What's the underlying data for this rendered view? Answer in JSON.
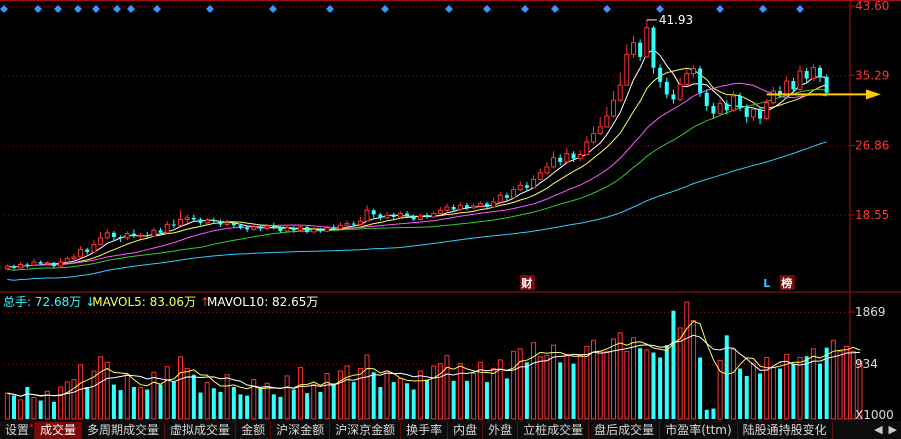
{
  "stock_name": "■■■■",
  "chart_data": [
    {
      "type": "candlestick",
      "title": "",
      "y_ticks": [
        "43.60",
        "35.29",
        "26.86",
        "18.55"
      ],
      "ylim": [
        10.5,
        43.6
      ],
      "max_annotation": "41.93",
      "ma_colors": {
        "ma1": "#ffffff",
        "ma2": "#ffff55",
        "ma3": "#ff55ff",
        "ma4": "#33cc33",
        "ma5": "#33ccff"
      },
      "up_color": "#ff3333",
      "down_color": "#33ffff",
      "markers": [
        {
          "label": "财",
          "index": 78
        },
        {
          "label": "L",
          "index": 114
        },
        {
          "label": "榜",
          "index": 117
        }
      ],
      "arrow_target_price": 33.0,
      "candles": [
        {
          "o": 12.1,
          "c": 12.4,
          "h": 12.6,
          "l": 11.9
        },
        {
          "o": 12.4,
          "c": 12.2,
          "h": 12.6,
          "l": 12.0
        },
        {
          "o": 12.2,
          "c": 12.6,
          "h": 12.9,
          "l": 12.1
        },
        {
          "o": 12.6,
          "c": 12.5,
          "h": 12.8,
          "l": 12.2
        },
        {
          "o": 12.5,
          "c": 12.9,
          "h": 13.3,
          "l": 12.4
        },
        {
          "o": 12.9,
          "c": 12.7,
          "h": 13.1,
          "l": 12.5
        },
        {
          "o": 12.7,
          "c": 12.8,
          "h": 13.0,
          "l": 12.5
        },
        {
          "o": 12.8,
          "c": 12.4,
          "h": 12.9,
          "l": 12.2
        },
        {
          "o": 12.4,
          "c": 12.9,
          "h": 13.4,
          "l": 12.3
        },
        {
          "o": 12.9,
          "c": 13.3,
          "h": 13.6,
          "l": 12.8
        },
        {
          "o": 13.3,
          "c": 13.5,
          "h": 13.9,
          "l": 13.1
        },
        {
          "o": 13.5,
          "c": 14.4,
          "h": 14.8,
          "l": 13.4
        },
        {
          "o": 14.4,
          "c": 14.1,
          "h": 14.6,
          "l": 13.8
        },
        {
          "o": 14.1,
          "c": 15.0,
          "h": 15.5,
          "l": 14.0
        },
        {
          "o": 15.0,
          "c": 15.8,
          "h": 16.5,
          "l": 14.9
        },
        {
          "o": 15.8,
          "c": 16.4,
          "h": 16.8,
          "l": 15.6
        },
        {
          "o": 16.4,
          "c": 15.9,
          "h": 16.6,
          "l": 15.5
        },
        {
          "o": 15.9,
          "c": 15.8,
          "h": 16.1,
          "l": 15.3
        },
        {
          "o": 15.8,
          "c": 16.3,
          "h": 16.6,
          "l": 15.5
        },
        {
          "o": 16.3,
          "c": 16.0,
          "h": 16.8,
          "l": 15.8
        },
        {
          "o": 16.0,
          "c": 16.1,
          "h": 16.4,
          "l": 15.7
        },
        {
          "o": 16.1,
          "c": 16.0,
          "h": 16.5,
          "l": 15.8
        },
        {
          "o": 16.0,
          "c": 16.7,
          "h": 17.0,
          "l": 15.9
        },
        {
          "o": 16.7,
          "c": 16.4,
          "h": 17.0,
          "l": 16.1
        },
        {
          "o": 16.4,
          "c": 17.4,
          "h": 17.8,
          "l": 16.3
        },
        {
          "o": 17.4,
          "c": 17.3,
          "h": 18.0,
          "l": 17.0
        },
        {
          "o": 17.3,
          "c": 18.0,
          "h": 19.1,
          "l": 17.2
        },
        {
          "o": 18.0,
          "c": 18.2,
          "h": 18.6,
          "l": 17.6
        },
        {
          "o": 18.2,
          "c": 18.0,
          "h": 18.6,
          "l": 17.7
        },
        {
          "o": 18.0,
          "c": 17.6,
          "h": 18.2,
          "l": 17.3
        },
        {
          "o": 17.6,
          "c": 17.9,
          "h": 18.2,
          "l": 17.4
        },
        {
          "o": 17.9,
          "c": 17.8,
          "h": 18.2,
          "l": 17.5
        },
        {
          "o": 17.8,
          "c": 17.4,
          "h": 18.0,
          "l": 17.1
        },
        {
          "o": 17.4,
          "c": 17.6,
          "h": 18.0,
          "l": 17.2
        },
        {
          "o": 17.6,
          "c": 17.3,
          "h": 17.8,
          "l": 17.0
        },
        {
          "o": 17.3,
          "c": 17.0,
          "h": 17.5,
          "l": 16.8
        },
        {
          "o": 17.0,
          "c": 16.8,
          "h": 17.3,
          "l": 16.5
        },
        {
          "o": 16.8,
          "c": 17.1,
          "h": 17.4,
          "l": 16.6
        },
        {
          "o": 17.1,
          "c": 16.9,
          "h": 17.4,
          "l": 16.6
        },
        {
          "o": 16.9,
          "c": 17.2,
          "h": 17.5,
          "l": 16.7
        },
        {
          "o": 17.2,
          "c": 17.0,
          "h": 17.6,
          "l": 16.8
        },
        {
          "o": 17.0,
          "c": 16.6,
          "h": 17.2,
          "l": 16.4
        },
        {
          "o": 16.6,
          "c": 17.0,
          "h": 17.4,
          "l": 16.5
        },
        {
          "o": 17.0,
          "c": 16.7,
          "h": 17.2,
          "l": 16.4
        },
        {
          "o": 16.7,
          "c": 17.1,
          "h": 17.4,
          "l": 16.6
        },
        {
          "o": 17.1,
          "c": 16.5,
          "h": 17.2,
          "l": 16.3
        },
        {
          "o": 16.5,
          "c": 16.8,
          "h": 17.1,
          "l": 16.4
        },
        {
          "o": 16.8,
          "c": 16.6,
          "h": 17.0,
          "l": 16.4
        },
        {
          "o": 16.6,
          "c": 17.0,
          "h": 17.3,
          "l": 16.5
        },
        {
          "o": 17.0,
          "c": 16.9,
          "h": 17.4,
          "l": 16.7
        },
        {
          "o": 16.9,
          "c": 17.3,
          "h": 17.7,
          "l": 16.8
        },
        {
          "o": 17.3,
          "c": 17.5,
          "h": 17.9,
          "l": 17.1
        },
        {
          "o": 17.5,
          "c": 17.4,
          "h": 17.8,
          "l": 17.1
        },
        {
          "o": 17.4,
          "c": 17.8,
          "h": 18.3,
          "l": 17.3
        },
        {
          "o": 17.8,
          "c": 19.1,
          "h": 19.7,
          "l": 17.7
        },
        {
          "o": 19.1,
          "c": 18.6,
          "h": 19.3,
          "l": 18.2
        },
        {
          "o": 18.6,
          "c": 18.2,
          "h": 18.8,
          "l": 17.9
        },
        {
          "o": 18.2,
          "c": 18.5,
          "h": 18.9,
          "l": 18.0
        },
        {
          "o": 18.5,
          "c": 18.3,
          "h": 18.8,
          "l": 18.0
        },
        {
          "o": 18.3,
          "c": 18.7,
          "h": 19.0,
          "l": 18.1
        },
        {
          "o": 18.7,
          "c": 18.4,
          "h": 19.0,
          "l": 18.2
        },
        {
          "o": 18.4,
          "c": 18.0,
          "h": 18.6,
          "l": 17.8
        },
        {
          "o": 18.0,
          "c": 18.4,
          "h": 18.7,
          "l": 17.9
        },
        {
          "o": 18.4,
          "c": 18.3,
          "h": 18.8,
          "l": 18.1
        },
        {
          "o": 18.3,
          "c": 18.7,
          "h": 19.0,
          "l": 18.2
        },
        {
          "o": 18.7,
          "c": 19.1,
          "h": 19.5,
          "l": 18.5
        },
        {
          "o": 19.1,
          "c": 19.5,
          "h": 19.9,
          "l": 18.9
        },
        {
          "o": 19.5,
          "c": 19.2,
          "h": 19.8,
          "l": 18.9
        },
        {
          "o": 19.2,
          "c": 19.7,
          "h": 20.1,
          "l": 19.0
        },
        {
          "o": 19.7,
          "c": 19.4,
          "h": 20.0,
          "l": 19.1
        },
        {
          "o": 19.4,
          "c": 19.6,
          "h": 19.9,
          "l": 19.2
        },
        {
          "o": 19.6,
          "c": 19.9,
          "h": 20.2,
          "l": 19.4
        },
        {
          "o": 19.9,
          "c": 19.5,
          "h": 20.1,
          "l": 19.2
        },
        {
          "o": 19.5,
          "c": 20.1,
          "h": 20.6,
          "l": 19.4
        },
        {
          "o": 20.1,
          "c": 20.9,
          "h": 21.3,
          "l": 20.0
        },
        {
          "o": 20.9,
          "c": 20.6,
          "h": 21.2,
          "l": 20.3
        },
        {
          "o": 20.6,
          "c": 21.6,
          "h": 22.0,
          "l": 20.5
        },
        {
          "o": 21.6,
          "c": 22.1,
          "h": 22.6,
          "l": 21.4
        },
        {
          "o": 22.1,
          "c": 21.8,
          "h": 22.5,
          "l": 21.4
        },
        {
          "o": 21.8,
          "c": 22.8,
          "h": 23.3,
          "l": 21.7
        },
        {
          "o": 22.8,
          "c": 23.6,
          "h": 24.1,
          "l": 22.7
        },
        {
          "o": 23.6,
          "c": 24.3,
          "h": 24.9,
          "l": 23.4
        },
        {
          "o": 24.3,
          "c": 25.4,
          "h": 26.2,
          "l": 24.1
        },
        {
          "o": 25.4,
          "c": 24.9,
          "h": 25.8,
          "l": 24.5
        },
        {
          "o": 24.9,
          "c": 25.9,
          "h": 26.6,
          "l": 24.8
        },
        {
          "o": 25.9,
          "c": 25.3,
          "h": 26.2,
          "l": 24.9
        },
        {
          "o": 25.3,
          "c": 25.8,
          "h": 26.3,
          "l": 25.0
        },
        {
          "o": 25.8,
          "c": 27.3,
          "h": 28.0,
          "l": 25.7
        },
        {
          "o": 27.3,
          "c": 28.3,
          "h": 29.2,
          "l": 27.0
        },
        {
          "o": 28.3,
          "c": 29.1,
          "h": 30.3,
          "l": 28.1
        },
        {
          "o": 29.1,
          "c": 30.4,
          "h": 31.5,
          "l": 29.0
        },
        {
          "o": 30.4,
          "c": 32.3,
          "h": 33.4,
          "l": 30.2
        },
        {
          "o": 32.3,
          "c": 34.1,
          "h": 35.6,
          "l": 32.1
        },
        {
          "o": 34.1,
          "c": 37.8,
          "h": 39.0,
          "l": 34.0
        },
        {
          "o": 37.8,
          "c": 39.2,
          "h": 40.0,
          "l": 37.4
        },
        {
          "o": 39.2,
          "c": 37.5,
          "h": 39.6,
          "l": 37.0
        },
        {
          "o": 37.5,
          "c": 41.0,
          "h": 41.93,
          "l": 37.4
        },
        {
          "o": 41.0,
          "c": 36.2,
          "h": 41.2,
          "l": 35.5
        },
        {
          "o": 36.2,
          "c": 34.5,
          "h": 36.6,
          "l": 33.8
        },
        {
          "o": 34.5,
          "c": 33.0,
          "h": 35.0,
          "l": 32.5
        },
        {
          "o": 33.0,
          "c": 32.4,
          "h": 33.6,
          "l": 31.9
        },
        {
          "o": 32.4,
          "c": 34.2,
          "h": 35.0,
          "l": 32.2
        },
        {
          "o": 34.2,
          "c": 35.5,
          "h": 36.0,
          "l": 34.0
        },
        {
          "o": 35.5,
          "c": 36.1,
          "h": 36.5,
          "l": 35.0
        },
        {
          "o": 36.1,
          "c": 33.2,
          "h": 36.4,
          "l": 32.7
        },
        {
          "o": 33.2,
          "c": 31.6,
          "h": 33.6,
          "l": 31.0
        },
        {
          "o": 31.6,
          "c": 30.7,
          "h": 32.0,
          "l": 30.2
        },
        {
          "o": 30.7,
          "c": 31.9,
          "h": 32.4,
          "l": 30.5
        },
        {
          "o": 31.9,
          "c": 31.1,
          "h": 32.3,
          "l": 30.6
        },
        {
          "o": 31.1,
          "c": 32.8,
          "h": 33.4,
          "l": 30.9
        },
        {
          "o": 32.8,
          "c": 31.4,
          "h": 33.2,
          "l": 31.0
        },
        {
          "o": 31.4,
          "c": 30.3,
          "h": 31.8,
          "l": 29.6
        },
        {
          "o": 30.3,
          "c": 31.2,
          "h": 31.6,
          "l": 29.8
        },
        {
          "o": 31.2,
          "c": 30.1,
          "h": 31.5,
          "l": 29.4
        },
        {
          "o": 30.1,
          "c": 32.0,
          "h": 32.5,
          "l": 29.9
        },
        {
          "o": 32.0,
          "c": 33.4,
          "h": 33.9,
          "l": 31.8
        },
        {
          "o": 33.4,
          "c": 33.0,
          "h": 34.0,
          "l": 32.6
        },
        {
          "o": 33.0,
          "c": 34.6,
          "h": 35.2,
          "l": 32.8
        },
        {
          "o": 34.6,
          "c": 33.6,
          "h": 35.0,
          "l": 33.2
        },
        {
          "o": 33.6,
          "c": 35.8,
          "h": 36.5,
          "l": 33.4
        },
        {
          "o": 35.8,
          "c": 34.9,
          "h": 36.2,
          "l": 34.4
        },
        {
          "o": 34.9,
          "c": 36.2,
          "h": 36.7,
          "l": 34.6
        },
        {
          "o": 36.2,
          "c": 35.1,
          "h": 36.5,
          "l": 34.5
        },
        {
          "o": 35.1,
          "c": 33.2,
          "h": 35.4,
          "l": 32.9
        }
      ]
    },
    {
      "type": "bar",
      "title": "",
      "legend": [
        {
          "label": "总手: 72.68万",
          "color": "#33ffff"
        },
        {
          "label": "MAVOL5: 83.06万",
          "color": "#ffff55",
          "arrow": "down"
        },
        {
          "label": "MAVOL10: 82.65万",
          "color": "#ffffff",
          "arrow": "up"
        }
      ],
      "y_ticks": [
        "1869",
        "934",
        "X1000"
      ],
      "ylim": [
        0,
        1869
      ],
      "ma5_color": "#ffff55",
      "ma10_color": "#ffffff",
      "volumes": [
        420,
        380,
        310,
        520,
        350,
        300,
        450,
        280,
        520,
        600,
        640,
        880,
        520,
        780,
        1010,
        920,
        560,
        470,
        730,
        520,
        510,
        480,
        760,
        560,
        850,
        600,
        1010,
        820,
        720,
        430,
        590,
        500,
        440,
        720,
        520,
        400,
        380,
        640,
        520,
        580,
        400,
        360,
        700,
        480,
        840,
        420,
        560,
        440,
        740,
        580,
        780,
        860,
        600,
        820,
        1040,
        760,
        520,
        780,
        600,
        660,
        580,
        480,
        780,
        640,
        860,
        900,
        1030,
        620,
        900,
        620,
        740,
        920,
        600,
        820,
        960,
        660,
        1100,
        1140,
        920,
        1240,
        1010,
        1030,
        1200,
        920,
        1050,
        900,
        1040,
        1180,
        1280,
        1100,
        1100,
        1300,
        1400,
        1100,
        1320,
        1150,
        1120,
        1080,
        1000,
        1200,
        1550,
        1900,
        1900,
        1380,
        1000,
        800,
        1080,
        950,
        1360,
        1140,
        820,
        700,
        900,
        740,
        1000,
        840,
        820,
        1050,
        900,
        1000,
        1020,
        1140,
        900,
        1160,
        1280,
        1100,
        1180,
        1100,
        940
      ],
      "volume_overrides": {
        "100": 1760,
        "101": 1480,
        "103": 1600,
        "105": 150,
        "106": 170
      }
    }
  ],
  "tabs": [
    {
      "label": "设置",
      "dot": true,
      "active": false
    },
    {
      "label": "成交量",
      "dot": false,
      "active": true
    },
    {
      "label": "多周期成交量",
      "dot": false,
      "active": false
    },
    {
      "label": "虚拟成交量",
      "dot": false,
      "active": false
    },
    {
      "label": "金额",
      "dot": false,
      "active": false
    },
    {
      "label": "沪深金额",
      "dot": false,
      "active": false
    },
    {
      "label": "沪深京金额",
      "dot": false,
      "active": false
    },
    {
      "label": "换手率",
      "dot": false,
      "active": false
    },
    {
      "label": "内盘",
      "dot": false,
      "active": false
    },
    {
      "label": "外盘",
      "dot": false,
      "active": false
    },
    {
      "label": "立桩成交量",
      "dot": false,
      "active": false
    },
    {
      "label": "盘后成交量",
      "dot": false,
      "active": false
    },
    {
      "label": "市盈率(ttm)",
      "dot": false,
      "active": false
    },
    {
      "label": "陆股通持股变化",
      "dot": false,
      "active": false
    }
  ],
  "tab_arrows": {
    "left": "◀",
    "right": "▶"
  }
}
